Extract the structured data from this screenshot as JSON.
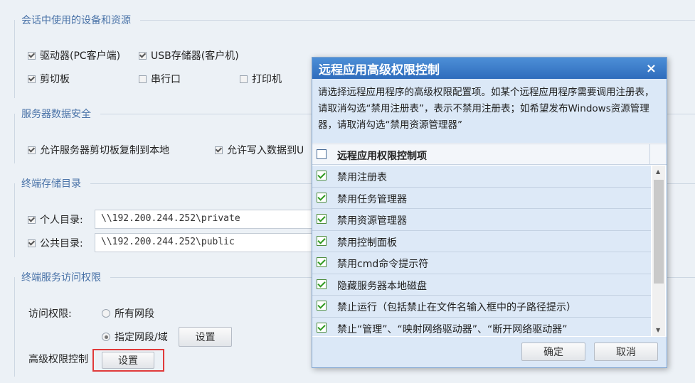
{
  "sections": {
    "devices": {
      "title": "会话中使用的设备和资源",
      "items": [
        {
          "label": "驱动器(PC客户端)",
          "checked": true
        },
        {
          "label": "USB存储器(客户机)",
          "checked": true
        },
        {
          "label": "剪切板",
          "checked": true
        },
        {
          "label": "串行口",
          "checked": false
        },
        {
          "label": "打印机",
          "checked": false
        }
      ]
    },
    "security": {
      "title": "服务器数据安全",
      "items": [
        {
          "label": "允许服务器剪切板复制到本地",
          "checked": true
        },
        {
          "label": "允许写入数据到U",
          "checked": true
        }
      ]
    },
    "storage": {
      "title": "终端存储目录",
      "personal_label": "个人目录:",
      "personal_path": "\\\\192.200.244.252\\private",
      "public_label": "公共目录:",
      "public_path": "\\\\192.200.244.252\\public"
    },
    "access": {
      "title": "终端服务访问权限",
      "access_label": "访问权限:",
      "radio_all": "所有网段",
      "radio_specified": "指定网段/域",
      "set_button": "设置",
      "advanced_label": "高级权限控制",
      "advanced_button": "设置"
    }
  },
  "dialog": {
    "title": "远程应用高级权限控制",
    "close": "×",
    "description": "请选择远程应用程序的高级权限配置项。如某个远程应用程序需要调用注册表，请取消勾选“禁用注册表”，表示不禁用注册表；如希望发布Windows资源管理器，请取消勾选“禁用资源管理器”",
    "header": "远程应用权限控制项",
    "rows": [
      {
        "label": "禁用注册表",
        "checked": true
      },
      {
        "label": "禁用任务管理器",
        "checked": true
      },
      {
        "label": "禁用资源管理器",
        "checked": true
      },
      {
        "label": "禁用控制面板",
        "checked": true
      },
      {
        "label": "禁用cmd命令提示符",
        "checked": true
      },
      {
        "label": "隐藏服务器本地磁盘",
        "checked": true
      },
      {
        "label": "禁止运行（包括禁止在文件名输入框中的子路径提示）",
        "checked": true
      },
      {
        "label": "禁止“管理”、“映射网络驱动器”、“断开网络驱动器”",
        "checked": true
      }
    ],
    "ok": "确定",
    "cancel": "取消"
  }
}
